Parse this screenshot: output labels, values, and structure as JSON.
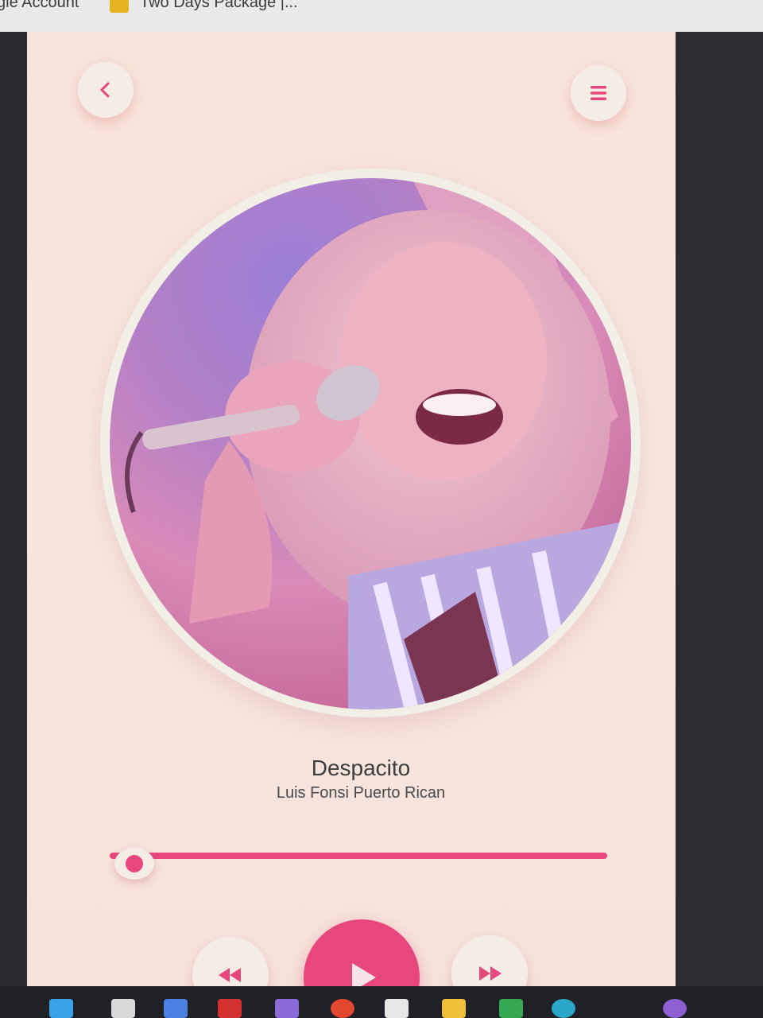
{
  "bookmarks": [
    {
      "label": "gle Account"
    },
    {
      "label": "Two Days Package |..."
    }
  ],
  "player": {
    "song_title": "Despacito",
    "artist": "Luis Fonsi Puerto Rican",
    "progress_fraction": 0.03
  },
  "colors": {
    "accent": "#e8477d",
    "panel_background": "#f7e3d9",
    "button_background": "#f6ece6"
  },
  "icons": {
    "back": "chevron-left-icon",
    "menu": "menu-icon",
    "rewind": "rewind-icon",
    "play": "play-icon",
    "forward": "fast-forward-icon"
  },
  "taskbar": {
    "items": [
      "windows-start",
      "task-view",
      "copilot",
      "pdf-reader",
      "camera",
      "chrome",
      "store",
      "file-explorer",
      "drive",
      "edge",
      "github"
    ]
  }
}
